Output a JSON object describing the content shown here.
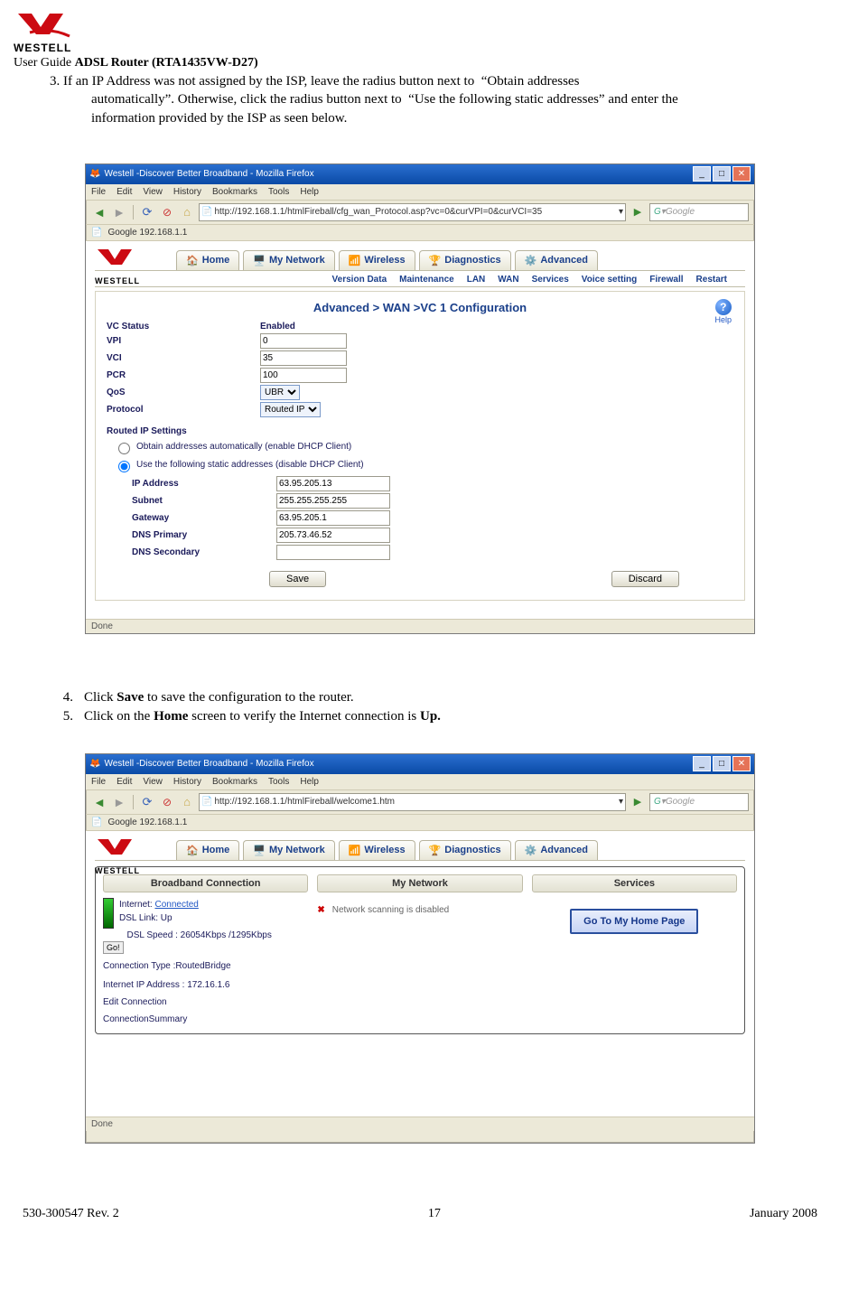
{
  "brand": "WESTELL",
  "header": {
    "userguide": "User Guide",
    "model": "ADSL Router (RTA1435VW-D27)"
  },
  "para3_lead": "3. If an IP Address was not assigned by the ISP, leave the radius button next to",
  "para3_q1a": "“Obtain addresses",
  "para3_line2a": "automatically”. Otherwise, click the radius button next to",
  "para3_q2": "“Use the following static addresses”",
  "para3_line2b": "and enter the",
  "para3_line3": "information provided by the ISP as seen below.",
  "shot1": {
    "title": "Westell -Discover Better Broadband - Mozilla Firefox",
    "menus": [
      "File",
      "Edit",
      "View",
      "History",
      "Bookmarks",
      "Tools",
      "Help"
    ],
    "url": "http://192.168.1.1/htmlFireball/cfg_wan_Protocol.asp?vc=0&curVPI=0&curVCI=35",
    "search_placeholder": "Google",
    "bookmark": "Google   192.168.1.1",
    "tabs": [
      "Home",
      "My Network",
      "Wireless",
      "Diagnostics",
      "Advanced"
    ],
    "subtabs": [
      "Version Data",
      "Maintenance",
      "LAN",
      "WAN",
      "Services",
      "Voice setting",
      "Firewall",
      "Restart"
    ],
    "panel_title": "Advanced > WAN >VC 1 Configuration",
    "help": "Help",
    "rows": {
      "vc_status_k": "VC Status",
      "vc_status_v": "Enabled",
      "vpi_k": "VPI",
      "vpi_v": "0",
      "vci_k": "VCI",
      "vci_v": "35",
      "pcr_k": "PCR",
      "pcr_v": "100",
      "qos_k": "QoS",
      "qos_v": "UBR",
      "proto_k": "Protocol",
      "proto_v": "Routed IP"
    },
    "section": "Routed IP Settings",
    "radio1": "Obtain addresses automatically (enable DHCP Client)",
    "radio2": "Use the following static addresses (disable DHCP Client)",
    "ip": {
      "addr_k": "IP Address",
      "addr_v": "63.95.205.13",
      "sub_k": "Subnet",
      "sub_v": "255.255.255.255",
      "gw_k": "Gateway",
      "gw_v": "63.95.205.1",
      "d1_k": "DNS Primary",
      "d1_v": "205.73.46.52",
      "d2_k": "DNS Secondary",
      "d2_v": ""
    },
    "save": "Save",
    "discard": "Discard",
    "status": "Done"
  },
  "step4_n": "4.",
  "step4": "Click ",
  "step4_b": "Save",
  "step4_t": " to save the configuration to the router.",
  "step5_n": "5.",
  "step5": "Click on the ",
  "step5_b": "Home",
  "step5_m": " screen to verify the Internet connection is ",
  "step5_b2": "Up.",
  "shot2": {
    "title": "Westell -Discover Better Broadband - Mozilla Firefox",
    "url": "http://192.168.1.1/htmlFireball/welcome1.htm",
    "bookmark": "Google   192.168.1.1",
    "tabs": [
      "Home",
      "My Network",
      "Wireless",
      "Diagnostics",
      "Advanced"
    ],
    "cols": [
      "Broadband Connection",
      "My Network",
      "Services"
    ],
    "internet_l": "Internet:",
    "internet_v": "Connected",
    "dsl": "DSL Link: Up",
    "speed": "DSL Speed : 26054Kbps /1295Kbps",
    "go": "Go!",
    "ctype": "Connection Type :RoutedBridge",
    "ipaddr": "Internet IP Address : 172.16.1.6",
    "edit": "Edit Connection",
    "summary": "ConnectionSummary",
    "netscan": "Network scanning is disabled",
    "svc": "Go To My Home Page",
    "status": "Done"
  },
  "footer": {
    "left": "530-300547 Rev. 2",
    "center": "17",
    "right": "January 2008"
  }
}
